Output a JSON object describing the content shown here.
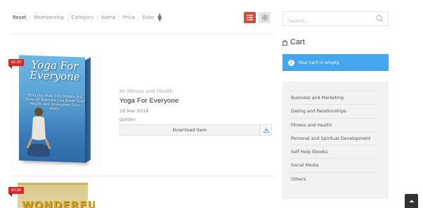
{
  "sort": {
    "items": [
      "Reset",
      "Membership",
      "Category",
      "Name",
      "Price",
      "Date"
    ]
  },
  "view": {
    "active": "list"
  },
  "products": [
    {
      "price": "€0.00",
      "cover_title": "Yoga For Everyone",
      "cover_subtitle": "Find Out How This Simple Art Form Of Exercise Can Boost Your Health And Strengthen Your Body!",
      "category_prefix": "In:",
      "category": "Fitness and Health",
      "title": "Yoga For Everyone",
      "date": "18 Mar 2018",
      "level": "Golden",
      "download_label": "Download Item"
    },
    {
      "price": "€0.00",
      "cover_title": "WONDERFUL"
    }
  ],
  "search": {
    "placeholder": "Search..."
  },
  "cart": {
    "title": "Cart",
    "empty_message": "Your cart is empty"
  },
  "categories": [
    "Business and Marketing",
    "Dating and Relationships",
    "Fitness and Health",
    "Personal and Spiritual Development",
    "Self Help Ebooks",
    "Social Media",
    "Others"
  ],
  "colors": {
    "accent_red": "#d64937",
    "info_blue": "#43a6ee",
    "badge_red": "#d32a2a"
  }
}
